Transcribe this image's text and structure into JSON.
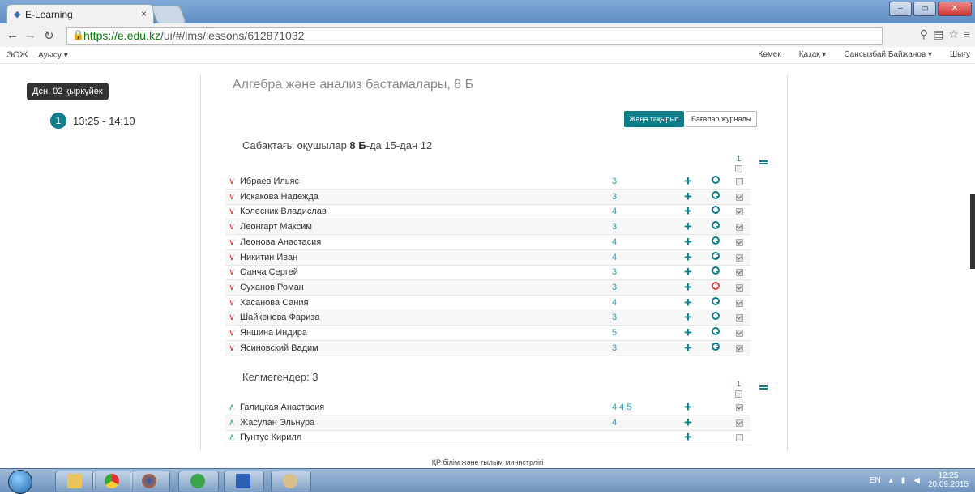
{
  "browser": {
    "tab_title": "E-Learning",
    "tab_close": "×",
    "url_host": "https://e.edu.kz",
    "url_path": "/ui/#/lms/lessons/612871032"
  },
  "appnav": {
    "brand": "ЭОЖ",
    "menu": "Ауысу ▾",
    "help": "Көмек",
    "language": "Қазақ ▾",
    "user": "Сансызбай Байжанов ▾",
    "logout": "Шығу"
  },
  "sidebar": {
    "date": "Дсн, 02 қыркүйек",
    "lesson_number": "1",
    "lesson_time": "13:25 - 14:10"
  },
  "main": {
    "course_title": "Алгебра және анализ бастамалары, 8 Б",
    "new_topic_button": "Жаңа тақырып",
    "journal_button": "Бағалар журналы",
    "present_prefix": "Сабақтағы оқушылар ",
    "present_class": "8 Б",
    "present_suffix": "-да 15-дан 12",
    "column_number": "1",
    "present_students": [
      {
        "name": "Ибраев Ильяс",
        "grade": "3",
        "checked": false,
        "clock": "teal"
      },
      {
        "name": "Искакова Надежда",
        "grade": "3",
        "checked": true,
        "clock": "teal"
      },
      {
        "name": "Колесник Владислав",
        "grade": "4",
        "checked": true,
        "clock": "teal"
      },
      {
        "name": "Леонгарт Максим",
        "grade": "3",
        "checked": true,
        "clock": "teal"
      },
      {
        "name": "Леонова Анастасия",
        "grade": "4",
        "checked": true,
        "clock": "teal"
      },
      {
        "name": "Никитин Иван",
        "grade": "4",
        "checked": true,
        "clock": "teal"
      },
      {
        "name": "Оанча Сергей",
        "grade": "3",
        "checked": true,
        "clock": "teal"
      },
      {
        "name": "Суханов Роман",
        "grade": "3",
        "checked": true,
        "clock": "red"
      },
      {
        "name": "Хасанова Сания",
        "grade": "4",
        "checked": true,
        "clock": "teal"
      },
      {
        "name": "Шайкенова Фариза",
        "grade": "3",
        "checked": true,
        "clock": "teal"
      },
      {
        "name": "Яншина Индира",
        "grade": "5",
        "checked": true,
        "clock": "teal"
      },
      {
        "name": "Ясиновский Вадим",
        "grade": "3",
        "checked": true,
        "clock": "teal"
      }
    ],
    "absent_title": "Келмегендер: 3",
    "absent_students": [
      {
        "name": "Галицкая Анастасия",
        "grade": "4 4 5",
        "checked": true
      },
      {
        "name": "Жасулан Эльнура",
        "grade": "4",
        "checked": true
      },
      {
        "name": "Пунтус Кирилл",
        "grade": "",
        "checked": false
      }
    ]
  },
  "footer": "ҚР білім және ғылым министрлігі",
  "taskbar": {
    "language": "EN",
    "time": "12:25",
    "date": "20.09.2015"
  }
}
